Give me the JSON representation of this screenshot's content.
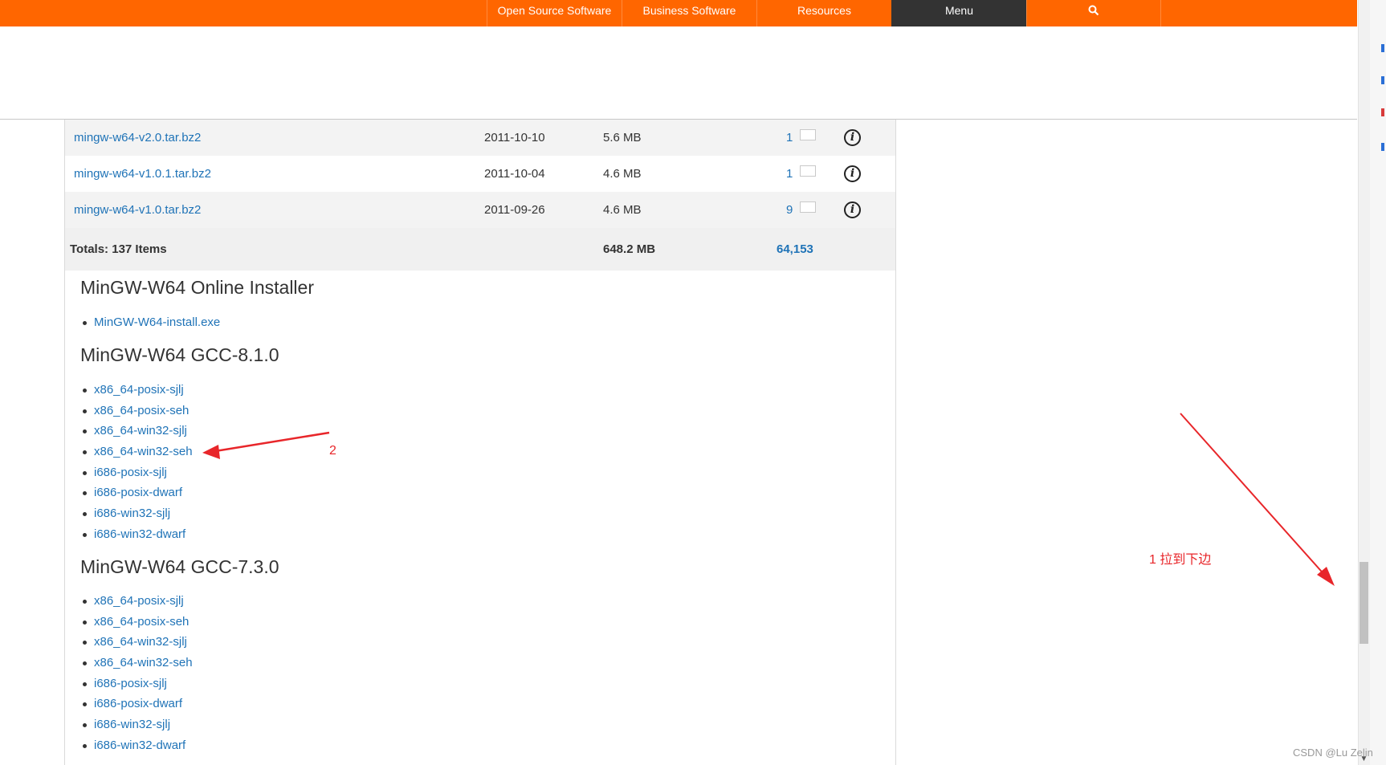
{
  "nav": {
    "items": [
      "Open Source Software",
      "Business Software",
      "Resources",
      "Menu"
    ],
    "search_icon": "search-icon"
  },
  "files": {
    "rows": [
      {
        "name": "mingw-w64-v2.0.tar.bz2",
        "date": "2011-10-10",
        "size": "5.6 MB",
        "downloads": "1"
      },
      {
        "name": "mingw-w64-v1.0.1.tar.bz2",
        "date": "2011-10-04",
        "size": "4.6 MB",
        "downloads": "1"
      },
      {
        "name": "mingw-w64-v1.0.tar.bz2",
        "date": "2011-09-26",
        "size": "4.6 MB",
        "downloads": "9"
      }
    ],
    "totals": {
      "label": "Totals: 137 Items",
      "size": "648.2 MB",
      "downloads": "64,153"
    }
  },
  "sections": [
    {
      "title": "MinGW-W64 Online Installer",
      "links": [
        "MinGW-W64-install.exe"
      ]
    },
    {
      "title": "MinGW-W64 GCC-8.1.0",
      "links": [
        "x86_64-posix-sjlj",
        "x86_64-posix-seh",
        "x86_64-win32-sjlj",
        "x86_64-win32-seh",
        "i686-posix-sjlj",
        "i686-posix-dwarf",
        "i686-win32-sjlj",
        "i686-win32-dwarf"
      ]
    },
    {
      "title": "MinGW-W64 GCC-7.3.0",
      "links": [
        "x86_64-posix-sjlj",
        "x86_64-posix-seh",
        "x86_64-win32-sjlj",
        "x86_64-win32-seh",
        "i686-posix-sjlj",
        "i686-posix-dwarf",
        "i686-win32-sjlj",
        "i686-win32-dwarf"
      ]
    }
  ],
  "annotations": {
    "step1": "1 拉到下边",
    "step2": "2"
  },
  "watermark": "CSDN @Lu Zelin",
  "colors": {
    "nav": "#ff6600",
    "link": "#1f73b7",
    "annotation": "#e8262a"
  }
}
